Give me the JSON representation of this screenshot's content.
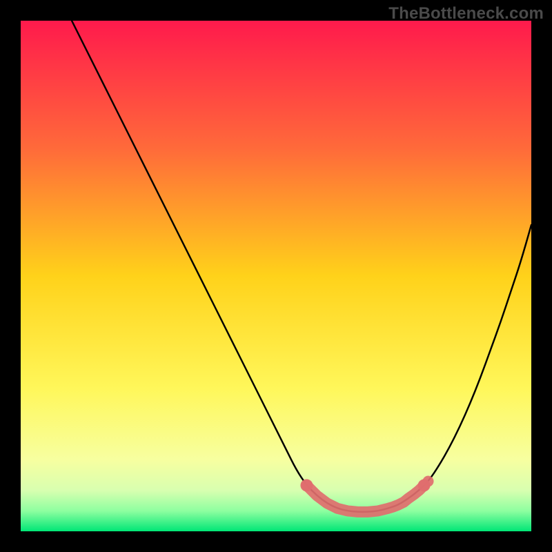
{
  "watermark": "TheBottleneck.com",
  "colors": {
    "frame": "#000000",
    "watermark": "#4a4a4a",
    "curve_stroke": "#000000",
    "marker_fill": "#e06e6e",
    "gradient_stops": [
      {
        "offset": 0.0,
        "color": "#ff1a4c"
      },
      {
        "offset": 0.25,
        "color": "#ff6a3a"
      },
      {
        "offset": 0.5,
        "color": "#ffd21a"
      },
      {
        "offset": 0.72,
        "color": "#fff75a"
      },
      {
        "offset": 0.86,
        "color": "#f7ffa0"
      },
      {
        "offset": 0.92,
        "color": "#d8ffb0"
      },
      {
        "offset": 0.96,
        "color": "#8effa0"
      },
      {
        "offset": 1.0,
        "color": "#00e676"
      }
    ]
  },
  "chart_data": {
    "type": "line",
    "title": "",
    "xlabel": "",
    "ylabel": "",
    "xlim": [
      0,
      100
    ],
    "ylim": [
      0,
      100
    ],
    "series": [
      {
        "name": "curve-left",
        "x": [
          10,
          15,
          20,
          25,
          30,
          35,
          40,
          45,
          50,
          52,
          54,
          56,
          58,
          60,
          62,
          64,
          66,
          68,
          70,
          72
        ],
        "values": [
          100,
          90,
          80,
          70,
          60,
          50,
          40,
          30,
          20,
          16,
          12,
          9,
          7,
          5.5,
          4.5,
          4,
          3.8,
          3.8,
          4,
          4.5
        ]
      },
      {
        "name": "curve-right",
        "x": [
          72,
          74,
          76,
          78,
          80,
          82,
          84,
          86,
          88,
          90,
          92,
          94,
          96,
          98,
          100
        ],
        "values": [
          4.5,
          5.2,
          6.5,
          8,
          10,
          13,
          16.5,
          20.5,
          25,
          30,
          35.5,
          41,
          47,
          53,
          60
        ]
      }
    ],
    "bottom_marker": {
      "name": "bottom-highlight",
      "x": [
        56,
        58,
        60,
        62,
        64,
        66,
        68,
        70,
        72,
        73,
        74,
        75,
        76,
        77,
        78,
        78.5,
        79
      ],
      "values": [
        9,
        7,
        5.5,
        4.5,
        4,
        3.8,
        3.8,
        4,
        4.5,
        4.8,
        5.2,
        5.7,
        6.5,
        7.2,
        8,
        8.5,
        9
      ]
    }
  }
}
